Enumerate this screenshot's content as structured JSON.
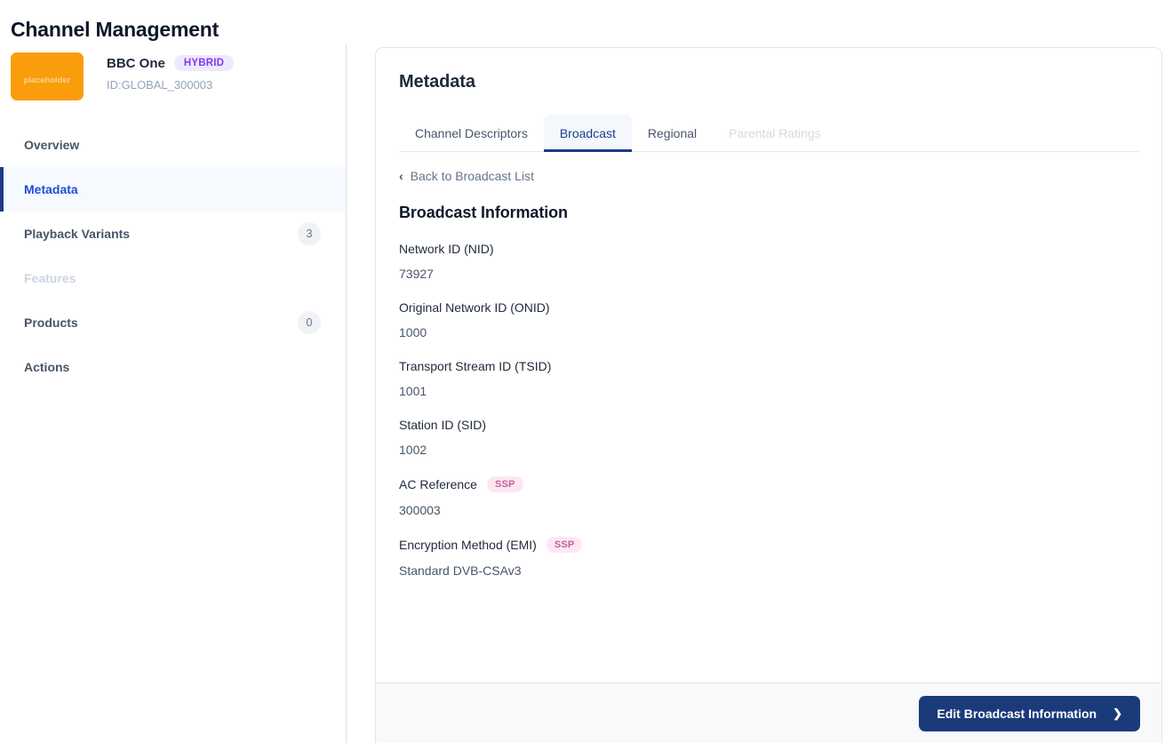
{
  "page": {
    "title": "Channel Management"
  },
  "channel": {
    "logo_text": "placeholder",
    "logo_color": "#f99d0c",
    "name": "BBC One",
    "type_badge": "HYBRID",
    "type_badge_bg": "#ede9fe",
    "type_badge_color": "#7c3aed",
    "id_label": "ID:GLOBAL_300003"
  },
  "sidebar": {
    "items": [
      {
        "label": "Overview",
        "count": "",
        "active": false,
        "disabled": false
      },
      {
        "label": "Metadata",
        "count": "",
        "active": true,
        "disabled": false
      },
      {
        "label": "Playback Variants",
        "count": "3",
        "active": false,
        "disabled": false
      },
      {
        "label": "Features",
        "count": "",
        "active": false,
        "disabled": true
      },
      {
        "label": "Products",
        "count": "0",
        "active": false,
        "disabled": false
      },
      {
        "label": "Actions",
        "count": "",
        "active": false,
        "disabled": false
      }
    ]
  },
  "main": {
    "card_title": "Metadata",
    "tabs": [
      {
        "label": "Channel Descriptors",
        "active": false,
        "disabled": false
      },
      {
        "label": "Broadcast",
        "active": true,
        "disabled": false
      },
      {
        "label": "Regional",
        "active": false,
        "disabled": false
      },
      {
        "label": "Parental Ratings",
        "active": false,
        "disabled": true
      }
    ],
    "back_link": "Back to Broadcast List",
    "back_icon": "chevron-left-icon",
    "section_title": "Broadcast Information",
    "fields": [
      {
        "label": "Network ID (NID)",
        "value": "73927",
        "badge": ""
      },
      {
        "label": "Original Network ID (ONID)",
        "value": "1000",
        "badge": ""
      },
      {
        "label": "Transport Stream ID (TSID)",
        "value": "1001",
        "badge": ""
      },
      {
        "label": "Station ID (SID)",
        "value": "1002",
        "badge": ""
      },
      {
        "label": "AC Reference",
        "value": "300003",
        "badge": "SSP"
      },
      {
        "label": "Encryption Method (EMI)",
        "value": "Standard DVB-CSAv3",
        "badge": "SSP"
      }
    ]
  },
  "footer": {
    "primary_button": "Edit Broadcast Information",
    "primary_button_icon": "chevron-right-icon",
    "primary_button_color": "#1b3a7a"
  }
}
